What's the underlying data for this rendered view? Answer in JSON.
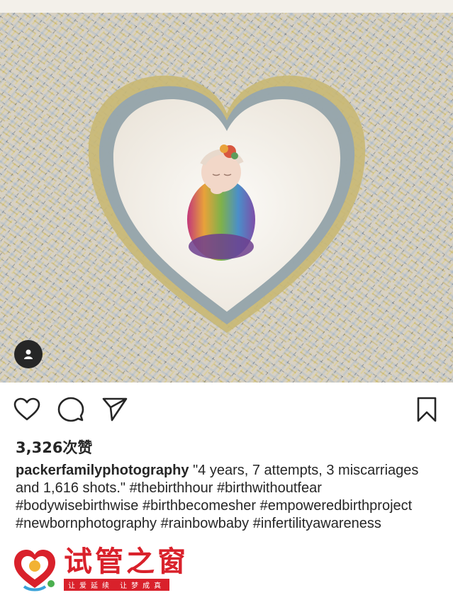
{
  "post": {
    "likes_label": "3,326次赞",
    "username": "packerfamilyphotography",
    "caption_text": "\"4 years, 7 attempts, 3 miscarriages and 1,616 shots.\"",
    "hashtags": [
      "#thebirthhour",
      "#birthwithoutfear",
      "#bodywisebirthwise",
      "#birthbecomesher",
      "#empoweredbirthproject",
      "#newbornphotography",
      "#rainbowbaby",
      "#infertilityawareness"
    ]
  },
  "icons": {
    "like": "heart-outline-icon",
    "comment": "speech-bubble-icon",
    "share": "paper-plane-icon",
    "save": "bookmark-icon",
    "user_tag": "person-icon"
  },
  "watermark": {
    "title": "试管之窗",
    "slogan": "让爱延续 让梦成真"
  },
  "colors": {
    "text": "#262626",
    "watermark_red": "#d9212b",
    "background": "#ffffff"
  }
}
